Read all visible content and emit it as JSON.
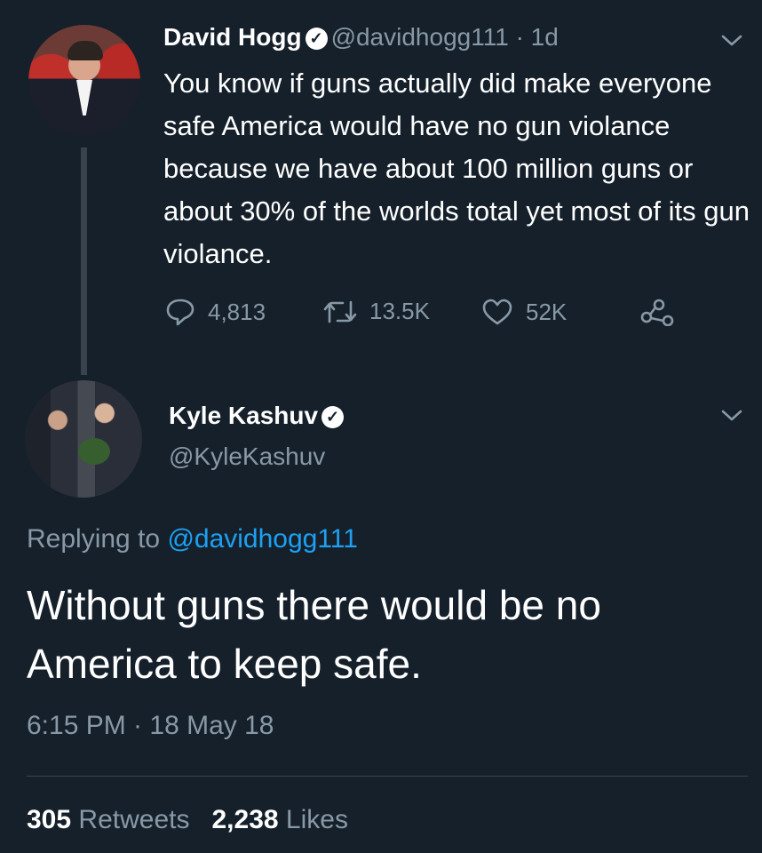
{
  "tweet1": {
    "name": "David Hogg",
    "handle": "@davidhogg111",
    "separator": "·",
    "age": "1d",
    "text": "You know if guns actually did make everyone safe America would have no gun violance because we have about 100 million guns or about 30% of the worlds total yet most of its gun violance.",
    "replies": "4,813",
    "retweets": "13.5K",
    "likes": "52K",
    "icons": [
      "reply-icon",
      "retweet-icon",
      "like-icon",
      "share-icon",
      "verified-icon",
      "chevron-down-icon"
    ]
  },
  "tweet2": {
    "name": "Kyle Kashuv",
    "handle": "@KyleKashuv",
    "replying_to_label": "Replying to",
    "replying_to_handle": "@davidhogg111",
    "text": "Without guns there would be no America to keep safe.",
    "timestamp": "6:15 PM · 18 May 18",
    "retweets_count": "305",
    "retweets_label": "Retweets",
    "likes_count": "2,238",
    "likes_label": "Likes"
  },
  "colors": {
    "background": "#15202b",
    "secondary_text": "#8899a6",
    "link": "#1da1f2",
    "divider": "#38444d"
  }
}
